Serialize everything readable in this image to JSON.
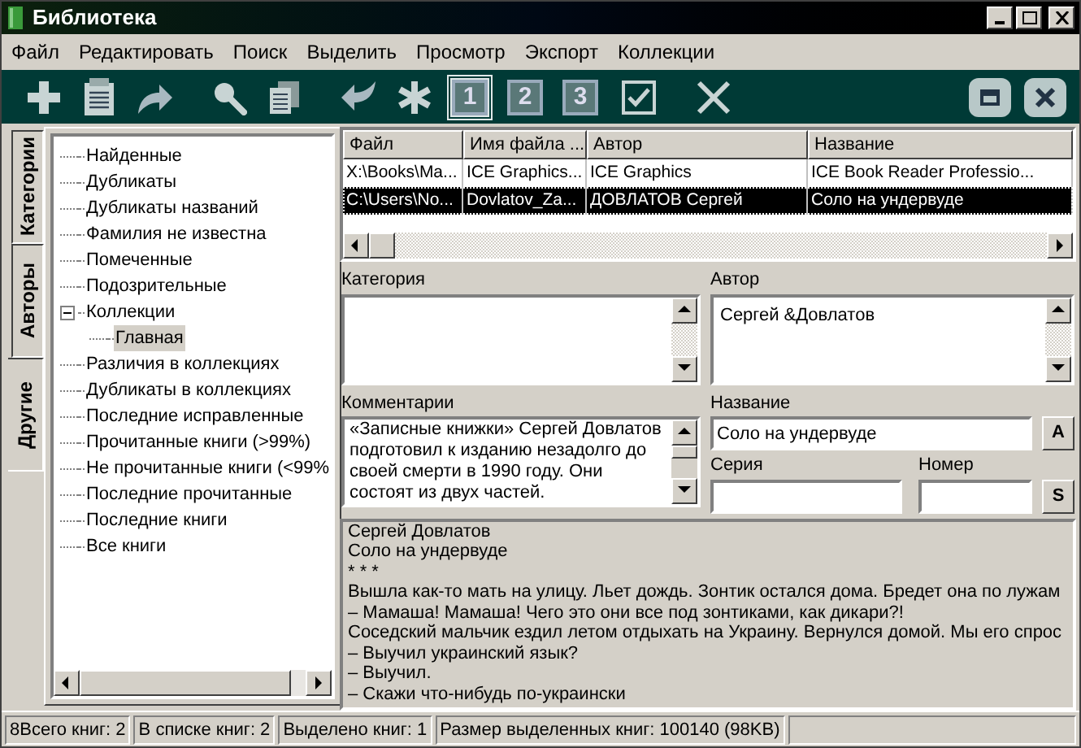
{
  "window": {
    "title": "Библиотека"
  },
  "menu": [
    "Файл",
    "Редактировать",
    "Поиск",
    "Выделить",
    "Просмотр",
    "Экспорт",
    "Коллекции"
  ],
  "toolbar": [
    {
      "kind": "plus",
      "selected": false
    },
    {
      "kind": "document",
      "selected": false
    },
    {
      "kind": "redo",
      "selected": false
    },
    {
      "kind": "search",
      "selected": false
    },
    {
      "kind": "pages",
      "selected": false
    },
    {
      "kind": "undo",
      "selected": false
    },
    {
      "kind": "asterisk",
      "selected": false
    },
    {
      "kind": "number",
      "label": "1",
      "selected": true
    },
    {
      "kind": "number",
      "label": "2",
      "selected": false
    },
    {
      "kind": "number",
      "label": "3",
      "selected": false
    },
    {
      "kind": "check",
      "selected": false
    },
    {
      "kind": "cross",
      "selected": false
    }
  ],
  "side_tabs": [
    {
      "label": "Категории",
      "selected": false
    },
    {
      "label": "Авторы",
      "selected": false
    },
    {
      "label": "Другие",
      "selected": true
    }
  ],
  "tree": [
    {
      "label": "Найденные",
      "selected": false
    },
    {
      "label": "Дубликаты",
      "selected": false
    },
    {
      "label": "Дубликаты названий",
      "selected": false
    },
    {
      "label": "Фамилия не известна",
      "selected": false
    },
    {
      "label": "Помеченные",
      "selected": false
    },
    {
      "label": "Подозрительные",
      "selected": false
    },
    {
      "label": "Коллекции",
      "selected": false,
      "expanded": true,
      "children": [
        {
          "label": "Главная",
          "selected": true
        }
      ]
    },
    {
      "label": "Различия в коллекциях",
      "selected": false
    },
    {
      "label": "Дубликаты в коллекциях",
      "selected": false
    },
    {
      "label": "Последние исправленные",
      "selected": false
    },
    {
      "label": "Прочитанные книги (>99%)",
      "selected": false
    },
    {
      "label": "Не прочитанные книги (<99%",
      "selected": false
    },
    {
      "label": "Последние прочитанные",
      "selected": false
    },
    {
      "label": "Последние книги",
      "selected": false
    },
    {
      "label": "Все книги",
      "selected": false
    }
  ],
  "table": {
    "columns": [
      "Файл",
      "Имя файла ...",
      "Автор",
      "Название"
    ],
    "rows": [
      {
        "cells": [
          "X:\\Books\\Ma...",
          "ICE Graphics...",
          "ICE Graphics",
          "ICE Book Reader Professio..."
        ],
        "selected": false
      },
      {
        "cells": [
          "C:\\Users\\No...",
          "Dovlatov_Za...",
          "ДОВЛАТОВ Сергей",
          "Соло на ундервуде"
        ],
        "selected": true
      }
    ]
  },
  "details": {
    "category_label": "Категория",
    "author_label": "Автор",
    "author_value": "Сергей &Довлатов",
    "comments_label": "Комментарии",
    "comments_value": "«Записные книжки» Сергей Довлатов подготовил к изданию незадолго до своей смерти в 1990 году. Они состоят из двух частей.",
    "title_label": "Название",
    "title_value": "Соло на ундервуде",
    "title_button": "A",
    "series_label": "Серия",
    "number_label": "Номер",
    "series_button": "S"
  },
  "preview": [
    "Сергей Довлатов",
    "Соло на ундервуде",
    "* * *",
    "Вышла как-то мать на улицу. Льет дождь. Зонтик остался дома. Бредет она по лужам",
    "– Мамаша! Мамаша! Чего это они все под зонтиками, как дикари?!",
    "Соседский мальчик ездил летом отдыхать на Украину. Вернулся домой. Мы его спрос",
    "– Выучил украинский язык?",
    "– Выучил.",
    "– Скажи что-нибудь по-украински"
  ],
  "status_bar": [
    "8Всего книг: 2",
    "В списке книг: 2",
    "Выделено книг: 1",
    "Размер выделенных книг: 100140  (98KB)"
  ]
}
